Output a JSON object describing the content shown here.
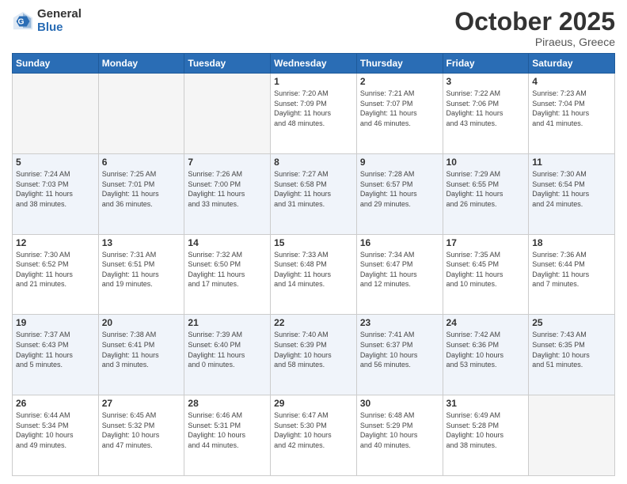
{
  "header": {
    "logo_general": "General",
    "logo_blue": "Blue",
    "month": "October 2025",
    "location": "Piraeus, Greece"
  },
  "days_of_week": [
    "Sunday",
    "Monday",
    "Tuesday",
    "Wednesday",
    "Thursday",
    "Friday",
    "Saturday"
  ],
  "weeks": [
    [
      {
        "day": "",
        "info": ""
      },
      {
        "day": "",
        "info": ""
      },
      {
        "day": "",
        "info": ""
      },
      {
        "day": "1",
        "info": "Sunrise: 7:20 AM\nSunset: 7:09 PM\nDaylight: 11 hours\nand 48 minutes."
      },
      {
        "day": "2",
        "info": "Sunrise: 7:21 AM\nSunset: 7:07 PM\nDaylight: 11 hours\nand 46 minutes."
      },
      {
        "day": "3",
        "info": "Sunrise: 7:22 AM\nSunset: 7:06 PM\nDaylight: 11 hours\nand 43 minutes."
      },
      {
        "day": "4",
        "info": "Sunrise: 7:23 AM\nSunset: 7:04 PM\nDaylight: 11 hours\nand 41 minutes."
      }
    ],
    [
      {
        "day": "5",
        "info": "Sunrise: 7:24 AM\nSunset: 7:03 PM\nDaylight: 11 hours\nand 38 minutes."
      },
      {
        "day": "6",
        "info": "Sunrise: 7:25 AM\nSunset: 7:01 PM\nDaylight: 11 hours\nand 36 minutes."
      },
      {
        "day": "7",
        "info": "Sunrise: 7:26 AM\nSunset: 7:00 PM\nDaylight: 11 hours\nand 33 minutes."
      },
      {
        "day": "8",
        "info": "Sunrise: 7:27 AM\nSunset: 6:58 PM\nDaylight: 11 hours\nand 31 minutes."
      },
      {
        "day": "9",
        "info": "Sunrise: 7:28 AM\nSunset: 6:57 PM\nDaylight: 11 hours\nand 29 minutes."
      },
      {
        "day": "10",
        "info": "Sunrise: 7:29 AM\nSunset: 6:55 PM\nDaylight: 11 hours\nand 26 minutes."
      },
      {
        "day": "11",
        "info": "Sunrise: 7:30 AM\nSunset: 6:54 PM\nDaylight: 11 hours\nand 24 minutes."
      }
    ],
    [
      {
        "day": "12",
        "info": "Sunrise: 7:30 AM\nSunset: 6:52 PM\nDaylight: 11 hours\nand 21 minutes."
      },
      {
        "day": "13",
        "info": "Sunrise: 7:31 AM\nSunset: 6:51 PM\nDaylight: 11 hours\nand 19 minutes."
      },
      {
        "day": "14",
        "info": "Sunrise: 7:32 AM\nSunset: 6:50 PM\nDaylight: 11 hours\nand 17 minutes."
      },
      {
        "day": "15",
        "info": "Sunrise: 7:33 AM\nSunset: 6:48 PM\nDaylight: 11 hours\nand 14 minutes."
      },
      {
        "day": "16",
        "info": "Sunrise: 7:34 AM\nSunset: 6:47 PM\nDaylight: 11 hours\nand 12 minutes."
      },
      {
        "day": "17",
        "info": "Sunrise: 7:35 AM\nSunset: 6:45 PM\nDaylight: 11 hours\nand 10 minutes."
      },
      {
        "day": "18",
        "info": "Sunrise: 7:36 AM\nSunset: 6:44 PM\nDaylight: 11 hours\nand 7 minutes."
      }
    ],
    [
      {
        "day": "19",
        "info": "Sunrise: 7:37 AM\nSunset: 6:43 PM\nDaylight: 11 hours\nand 5 minutes."
      },
      {
        "day": "20",
        "info": "Sunrise: 7:38 AM\nSunset: 6:41 PM\nDaylight: 11 hours\nand 3 minutes."
      },
      {
        "day": "21",
        "info": "Sunrise: 7:39 AM\nSunset: 6:40 PM\nDaylight: 11 hours\nand 0 minutes."
      },
      {
        "day": "22",
        "info": "Sunrise: 7:40 AM\nSunset: 6:39 PM\nDaylight: 10 hours\nand 58 minutes."
      },
      {
        "day": "23",
        "info": "Sunrise: 7:41 AM\nSunset: 6:37 PM\nDaylight: 10 hours\nand 56 minutes."
      },
      {
        "day": "24",
        "info": "Sunrise: 7:42 AM\nSunset: 6:36 PM\nDaylight: 10 hours\nand 53 minutes."
      },
      {
        "day": "25",
        "info": "Sunrise: 7:43 AM\nSunset: 6:35 PM\nDaylight: 10 hours\nand 51 minutes."
      }
    ],
    [
      {
        "day": "26",
        "info": "Sunrise: 6:44 AM\nSunset: 5:34 PM\nDaylight: 10 hours\nand 49 minutes."
      },
      {
        "day": "27",
        "info": "Sunrise: 6:45 AM\nSunset: 5:32 PM\nDaylight: 10 hours\nand 47 minutes."
      },
      {
        "day": "28",
        "info": "Sunrise: 6:46 AM\nSunset: 5:31 PM\nDaylight: 10 hours\nand 44 minutes."
      },
      {
        "day": "29",
        "info": "Sunrise: 6:47 AM\nSunset: 5:30 PM\nDaylight: 10 hours\nand 42 minutes."
      },
      {
        "day": "30",
        "info": "Sunrise: 6:48 AM\nSunset: 5:29 PM\nDaylight: 10 hours\nand 40 minutes."
      },
      {
        "day": "31",
        "info": "Sunrise: 6:49 AM\nSunset: 5:28 PM\nDaylight: 10 hours\nand 38 minutes."
      },
      {
        "day": "",
        "info": ""
      }
    ]
  ]
}
